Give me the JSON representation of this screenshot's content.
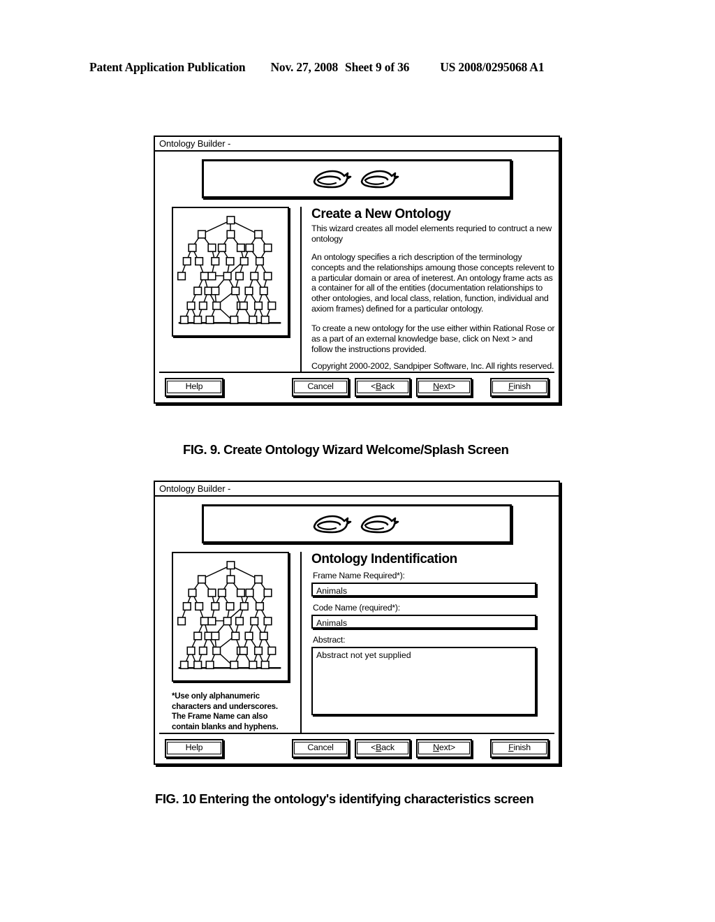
{
  "page_header": {
    "publication": "Patent Application Publication",
    "date": "Nov. 27, 2008",
    "sheet": "Sheet 9 of 36",
    "patent_number": "US 2008/0295068 A1"
  },
  "figure9": {
    "caption": "FIG. 9.  Create Ontology Wizard Welcome/Splash Screen",
    "window": {
      "title": "Ontology Builder -"
    },
    "logo": {
      "alt": "Sandpiper Software two-bird logo"
    },
    "heading": "Create a New Ontology",
    "paragraphs": [
      "This wizard creates all model elements requried to contruct a new ontology",
      "An ontology specifies a rich description of the terminology concepts and the relationships amoung those concepts relevent to a particular domain or area of ineterest.  An ontology frame acts as a container for all of the entities (documentation relationships to other ontologies, and local class, relation, function, individual and axiom frames) defined for a particular ontology.",
      "To create a new ontology for the use either within Rational Rose or as a part of an external knowledge base, click on Next > and follow the instructions provided.",
      "Copyright 2000-2002, Sandpiper Software, Inc. All rights reserved."
    ],
    "buttons": {
      "help": "Help",
      "cancel": "Cancel",
      "back_prefix": "<",
      "back_mnemonic": "B",
      "back_suffix": "ack",
      "next_mnemonic": "N",
      "next_suffix": "ext>",
      "finish_mnemonic": "F",
      "finish_suffix": "inish"
    }
  },
  "figure10": {
    "caption": "FIG. 10 Entering the ontology's  identifying characteristics screen",
    "window": {
      "title": "Ontology Builder -"
    },
    "logo": {
      "alt": "Sandpiper Software two-bird logo"
    },
    "heading": "Ontology Indentification",
    "fields": {
      "frame_name_label": "Frame Name Required*):",
      "frame_name_value": "Animals",
      "code_name_label": "Code Name (required*):",
      "code_name_value": "Animals",
      "abstract_label": "Abstract:",
      "abstract_value": "Abstract not yet supplied"
    },
    "note": "*Use only alphanumeric characters and underscores. The Frame Name can also contain blanks and hyphens.",
    "buttons": {
      "help": "Help",
      "cancel": "Cancel",
      "back_prefix": "<",
      "back_mnemonic": "B",
      "back_suffix": "ack",
      "next_mnemonic": "N",
      "next_suffix": "ext>",
      "finish_mnemonic": "F",
      "finish_suffix": "inish"
    }
  }
}
